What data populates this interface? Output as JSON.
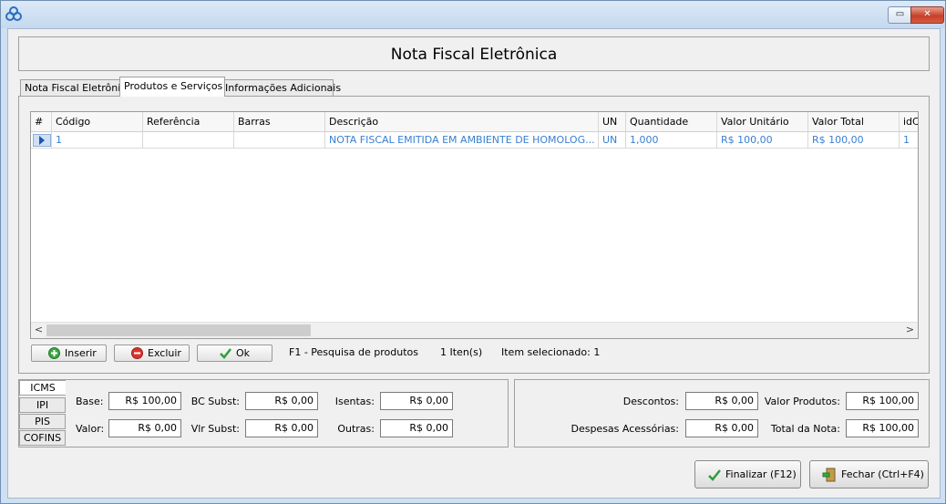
{
  "window": {
    "title": "Nota Fiscal Eletrônica",
    "min_glyph": "▭",
    "close_glyph": "✕"
  },
  "tabs": [
    "Nota Fiscal Eletrônica",
    "Produtos e Serviços",
    "Informações Adicionais"
  ],
  "active_tab": "Produtos e Serviços",
  "grid": {
    "columns": [
      "#",
      "Código",
      "Referência",
      "Barras",
      "Descrição",
      "UN",
      "Quantidade",
      "Valor Unitário",
      "Valor Total",
      "idC"
    ],
    "rows": [
      {
        "codigo": "1",
        "referencia": "",
        "barras": "",
        "descricao": "NOTA FISCAL EMITIDA EM AMBIENTE DE HOMOLOG...",
        "un": "UN",
        "quantidade": "1,000",
        "valor_unitario": "R$ 100,00",
        "valor_total": "R$ 100,00",
        "idc": "1"
      }
    ],
    "scroll_left": "<",
    "scroll_right": ">"
  },
  "actions": {
    "inserir": "Inserir",
    "excluir": "Excluir",
    "ok": "Ok",
    "hint": "F1 - Pesquisa de produtos",
    "count": "1 Iten(s)",
    "selected": "Item selecionado: 1"
  },
  "tax_tabs": [
    "ICMS",
    "IPI",
    "PIS",
    "COFINS"
  ],
  "tax_active": "ICMS",
  "tax_fields": {
    "base_label": "Base:",
    "base_value": "R$ 100,00",
    "valor_label": "Valor:",
    "valor_value": "R$ 0,00",
    "bc_subst_label": "BC Subst:",
    "bc_subst_value": "R$ 0,00",
    "vlr_subst_label": "Vlr Subst:",
    "vlr_subst_value": "R$ 0,00",
    "isentas_label": "Isentas:",
    "isentas_value": "R$ 0,00",
    "outras_label": "Outras:",
    "outras_value": "R$ 0,00"
  },
  "totals": {
    "descontos_label": "Descontos:",
    "descontos_value": "R$ 0,00",
    "despesas_label": "Despesas Acessórias:",
    "despesas_value": "R$ 0,00",
    "valor_produtos_label": "Valor Produtos:",
    "valor_produtos_value": "R$ 100,00",
    "total_nota_label": "Total da Nota:",
    "total_nota_value": "R$ 100,00"
  },
  "footer": {
    "finalizar": "Finalizar (F12)",
    "fechar": "Fechar (Ctrl+F4)"
  },
  "icons": {
    "app": "app-logo-icon",
    "inserir": "add-icon",
    "excluir": "remove-icon",
    "ok": "check-icon",
    "finalizar": "check-icon",
    "fechar": "exit-door-icon"
  },
  "colors": {
    "grid_text": "#3a7fd0",
    "titlebar": "#c5d8ef",
    "add_green": "#3aa640",
    "remove_red": "#d9342b",
    "check_green": "#2e9e3a"
  }
}
